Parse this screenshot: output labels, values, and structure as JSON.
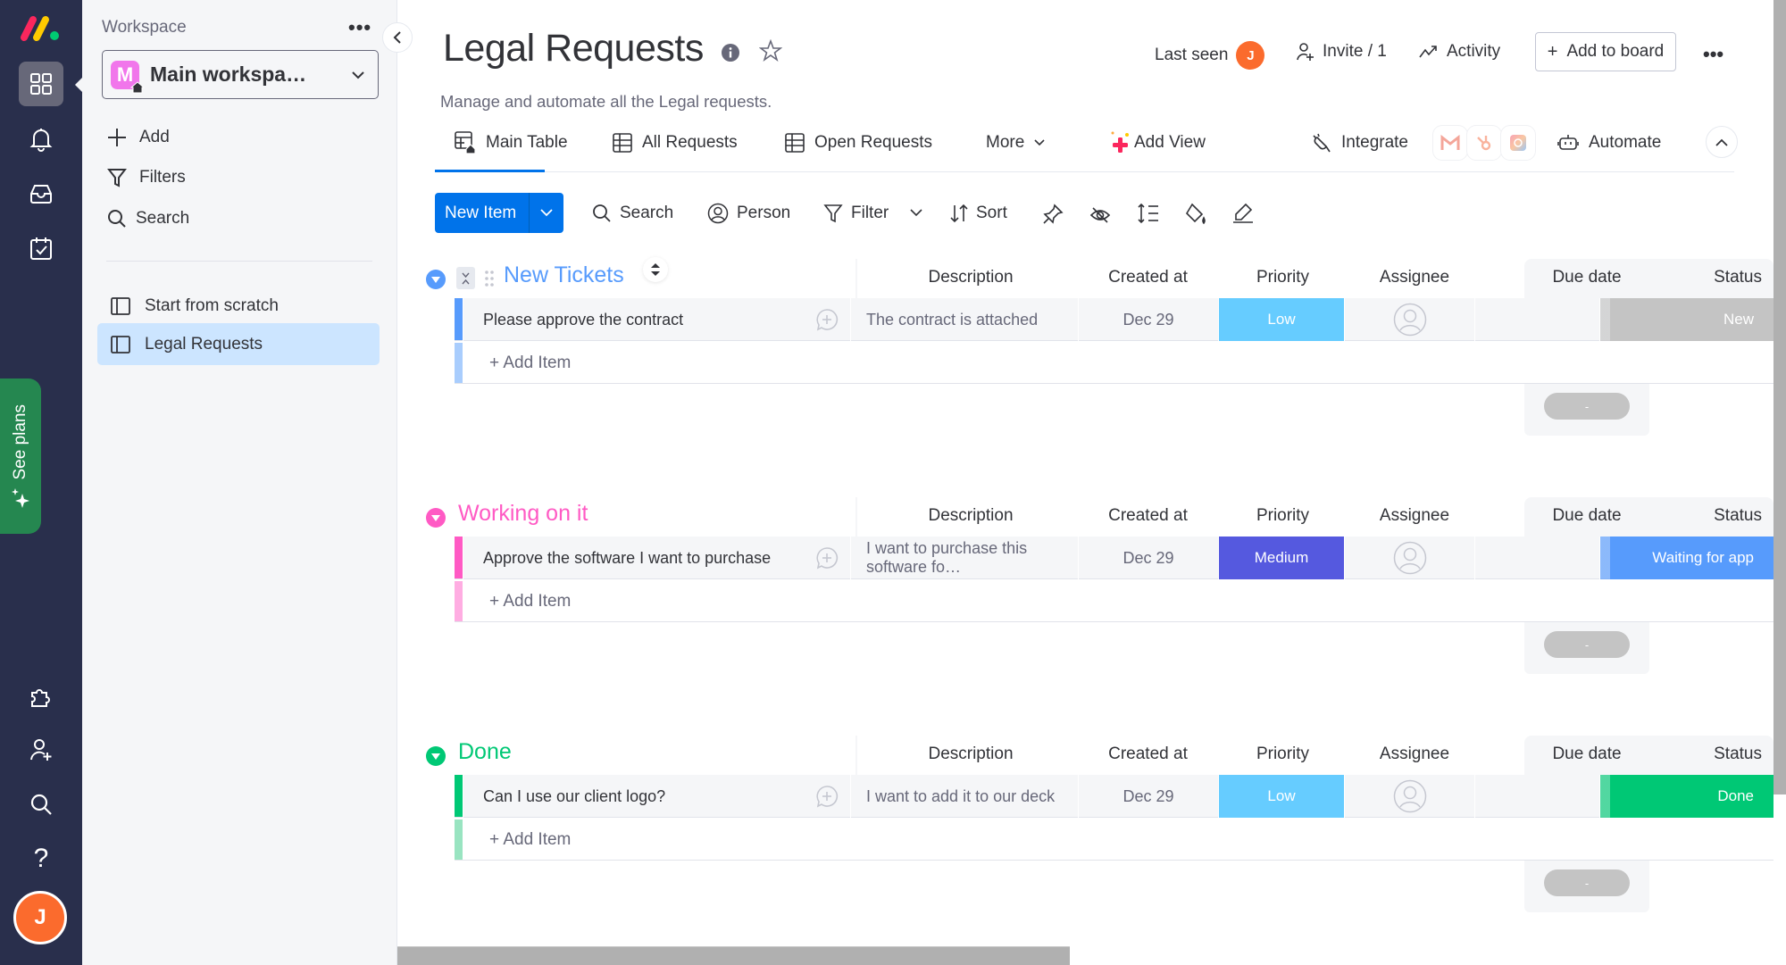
{
  "left_nav": {
    "items": [
      {
        "name": "workspaces",
        "icon": "grid-icon",
        "active": true
      },
      {
        "name": "notifications",
        "icon": "bell-icon"
      },
      {
        "name": "inbox",
        "icon": "inbox-icon"
      },
      {
        "name": "my-work",
        "icon": "calendar-check-icon"
      }
    ],
    "see_plans_label": "See plans",
    "bottom_items": [
      {
        "name": "apps",
        "icon": "puzzle-icon"
      },
      {
        "name": "invite-members",
        "icon": "person-add-icon"
      },
      {
        "name": "search",
        "icon": "search-icon"
      },
      {
        "name": "help",
        "icon": "help-icon",
        "glyph": "?"
      }
    ],
    "user_initial": "J"
  },
  "sidebar": {
    "workspace_label": "Workspace",
    "more_glyph": "•••",
    "workspace_initial": "M",
    "workspace_name": "Main workspa…",
    "actions": [
      {
        "label": "Add",
        "icon": "plus-icon"
      },
      {
        "label": "Filters",
        "icon": "filter-icon"
      },
      {
        "label": "Search",
        "icon": "search-icon"
      }
    ],
    "boards": [
      {
        "label": "Start from scratch",
        "active": false
      },
      {
        "label": "Legal Requests",
        "active": true
      }
    ]
  },
  "header": {
    "title": "Legal Requests",
    "description": "Manage and automate all the Legal requests.",
    "last_seen_label": "Last seen",
    "last_seen_initial": "J",
    "invite_label": "Invite / 1",
    "activity_label": "Activity",
    "add_to_board_label": "Add to board",
    "more_glyph": "•••"
  },
  "tabs": {
    "items": [
      {
        "label": "Main Table",
        "active": true
      },
      {
        "label": "All Requests",
        "active": false
      },
      {
        "label": "Open Requests",
        "active": false
      }
    ],
    "more_label": "More",
    "add_view_label": "Add View",
    "integrate_label": "Integrate",
    "integrations": [
      "Gmail",
      "HubSpot",
      "Adobe Creative Cloud"
    ],
    "automate_label": "Automate"
  },
  "toolbar": {
    "new_item_label": "New Item",
    "search_label": "Search",
    "person_label": "Person",
    "filter_label": "Filter",
    "sort_label": "Sort"
  },
  "columns": [
    "Description",
    "Created at",
    "Priority",
    "Assignee",
    "Due date",
    "Status"
  ],
  "groups": [
    {
      "title": "New Tickets",
      "color": "#579bfc",
      "color_light": "#a9cdfd",
      "items": [
        {
          "name": "Please approve the contract",
          "description": "The contract is attached",
          "created_at": "Dec 29",
          "priority": {
            "label": "Low",
            "color": "#66ccff"
          },
          "assignee": "",
          "due_date": "",
          "status": {
            "label": "New",
            "color": "#c4c4c4"
          }
        }
      ],
      "add_item_label": "+ Add Item",
      "due_summary": "-"
    },
    {
      "title": "Working on it",
      "color": "#ff5ac4",
      "color_light": "#ffade2",
      "items": [
        {
          "name": "Approve the software I want to purchase",
          "description": "I want to purchase this software fo…",
          "created_at": "Dec 29",
          "priority": {
            "label": "Medium",
            "color": "#5559df"
          },
          "assignee": "",
          "due_date": "",
          "status": {
            "label": "Waiting for app",
            "color": "#579bfc"
          }
        }
      ],
      "add_item_label": "+ Add Item",
      "due_summary": "-"
    },
    {
      "title": "Done",
      "color": "#00c875",
      "color_light": "#99e4c1",
      "items": [
        {
          "name": "Can I use our client logo?",
          "description": "I want to add it to our deck",
          "created_at": "Dec 29",
          "priority": {
            "label": "Low",
            "color": "#66ccff"
          },
          "assignee": "",
          "due_date": "",
          "status": {
            "label": "Done",
            "color": "#00c875"
          }
        }
      ],
      "add_item_label": "+ Add Item",
      "due_summary": "-"
    }
  ]
}
